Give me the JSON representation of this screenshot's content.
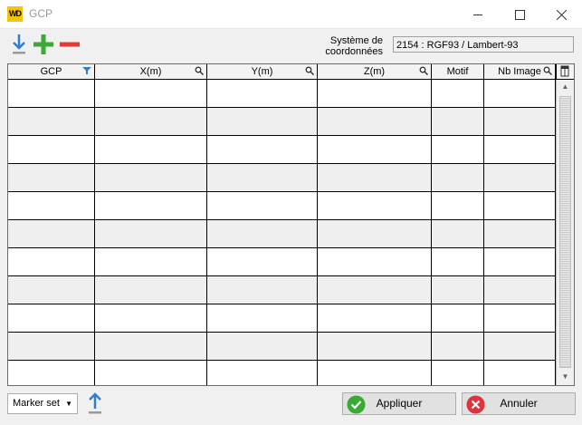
{
  "window": {
    "title": "GCP",
    "app_icon_text": "WD"
  },
  "toolbar": {
    "import_icon": "download-arrow-icon",
    "add_icon": "plus-icon",
    "remove_icon": "minus-icon"
  },
  "coordinate_system": {
    "label_line1": "Système de",
    "label_line2": "coordonnées",
    "value": "2154 : RGF93 / Lambert-93"
  },
  "table": {
    "columns": [
      {
        "label": "GCP",
        "icon": "filter-icon"
      },
      {
        "label": "X(m)",
        "icon": "search-icon"
      },
      {
        "label": "Y(m)",
        "icon": "search-icon"
      },
      {
        "label": "Z(m)",
        "icon": "search-icon"
      },
      {
        "label": "Motif",
        "icon": ""
      },
      {
        "label": "Nb Image",
        "icon": "search-icon"
      }
    ],
    "row_count": 11
  },
  "footer": {
    "marker_set_label": "Marker set",
    "apply_label": "Appliquer",
    "cancel_label": "Annuler"
  },
  "colors": {
    "add_green": "#3aa935",
    "remove_red": "#e53935",
    "import_blue": "#2f7fd0",
    "apply_green": "#3aa935",
    "cancel_red": "#e0333d",
    "title_icon_yellow": "#f5c400"
  }
}
